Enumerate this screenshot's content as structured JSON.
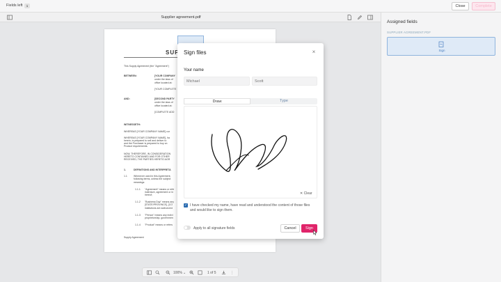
{
  "topbar": {
    "fields_left_label": "Fields left",
    "fields_left_count": "1",
    "close_label": "Close",
    "complete_label": "Complete"
  },
  "doc_toolbar": {
    "title": "Supplier agreement.pdf"
  },
  "right_panel": {
    "title": "Assigned fields",
    "section": "SUPPLIER AGREEMENT.PDF",
    "field_label": "Sign"
  },
  "document": {
    "heading": "SUPP",
    "lines": [
      "This Supply Agreement (the \"Agreement\")",
      "BETWEEN:",
      "[YOUR COMPANY",
      "under the laws of",
      "office located at:",
      "[YOUR COMPLETE",
      "AND:",
      "[SECOND PARTY",
      "under the laws of",
      "office located at:",
      "[COMPLETE ADD",
      "WITNESSETH:",
      "WHEREAS [YOUR COMPANY NAME] cur",
      "WHEREAS [YOUR COMPANY NAME], ha",
      "herein, is prepared to sell and deliver to",
      "and the Purchaser is prepared to buy on",
      "Product requirements.",
      "NOW, THEREFORE, IN CONSIDERATION",
      "HERETO CONTAINED AND FOR OTHER",
      "RECEIVED, THE PARTIES HERETO AGR",
      "1.",
      "DEFINITIONS AND INTERPRETA",
      "1.1",
      "Whenever used in this Agreement,",
      "following terms, unless the subject",
      "meanings:",
      "1.1.1",
      "\"Agreement\" means or refe",
      "indenture, agreement or in",
      "hereof;",
      "1.1.2",
      "\"Business Day\" means any",
      "[STATE/PROVINCE], [CO",
      "institutions are authorized",
      "1.1.3",
      "\"Person\" means any indivi",
      "proprietorship, governmen",
      "1.1.4",
      "\"Product\" means or refers",
      "Supply Agreement"
    ]
  },
  "modal": {
    "title": "Sign files",
    "name_label": "Your name",
    "first_name_placeholder": "Michael",
    "last_name_placeholder": "Scott",
    "tab_draw": "Draw",
    "tab_type": "Type",
    "clear_label": "Clear",
    "consent_text": "I have checked my name, have read and understood the content of those files and would like to sign them.",
    "apply_all_label": "Apply to all signature fields",
    "cancel_label": "Cancel",
    "sign_label": "Sign"
  },
  "bottom_toolbar": {
    "zoom": "100%",
    "page_indicator": "1 of 5"
  },
  "colors": {
    "accent": "#e0246a",
    "field_bg": "#dfeaf7",
    "field_border": "#8fb4dd"
  },
  "icons": [
    "sidebar-toggle-icon",
    "doc-icon",
    "pen-icon",
    "panel-icon",
    "close-icon",
    "zoom-icon",
    "page-icon",
    "more-icon",
    "sign-field-icon",
    "cursor-icon"
  ]
}
